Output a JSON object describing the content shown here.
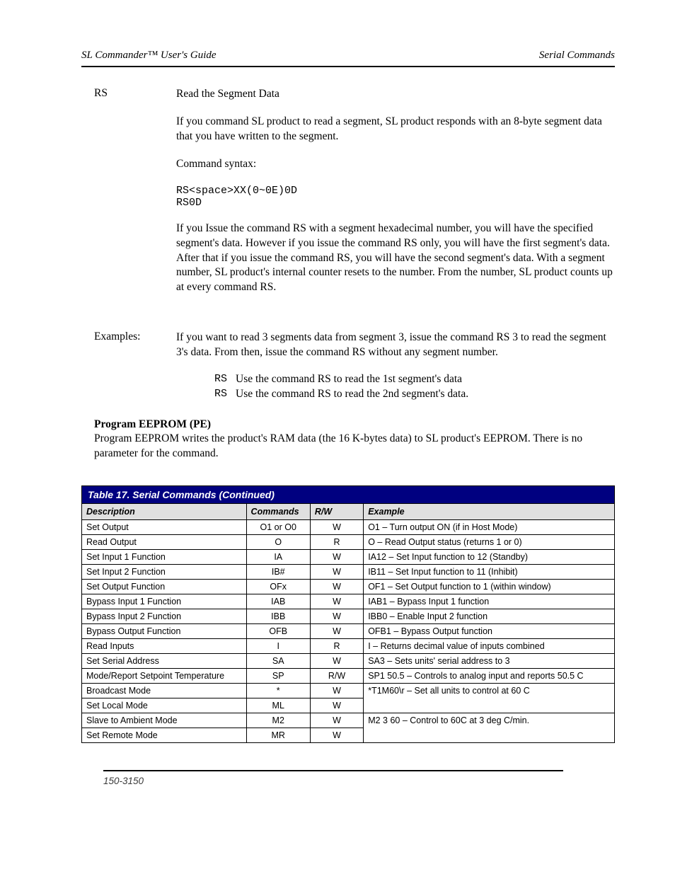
{
  "header": {
    "left": "SL Commander™ User's Guide",
    "right": "Serial Commands"
  },
  "rs": {
    "label": "RS",
    "p1": "Read the Segment Data",
    "p2": "If you command SL product to read a segment, SL product responds with an 8-byte segment data that you have written to the segment.",
    "syntax_label": "Command syntax:",
    "syntax_line1": "RS<space>XX(0~0E)0D",
    "syntax_line2": "RS0D",
    "p3": "If you Issue the command RS with a segment hexadecimal number, you will have the specified segment's data. However if you issue the command RS only, you will have the first segment's data. After that if you issue the command RS, you will have the second segment's data. With a segment number, SL product's internal counter resets to the number. From the number, SL product counts up at every command RS."
  },
  "ex": {
    "label": "Examples:",
    "p1": "If you want to read 3 segments data from segment 3, issue the command RS 3 to read the segment 3's data. From then, issue the command RS without any segment number.",
    "rows": [
      {
        "cmd": "RS",
        "desc": "Use the command RS to read the 1st segment's data"
      },
      {
        "cmd": "RS",
        "desc": "Use the command RS to read the 2nd segment's data."
      }
    ]
  },
  "pe": {
    "title": "Program EEPROM (PE)",
    "desc": "Program EEPROM writes the product's RAM data (the 16 K-bytes data) to SL product's EEPROM. There is no parameter for the command."
  },
  "table": {
    "title": "Table 17. Serial Commands (Continued)",
    "h_desc": "Description",
    "h_cmd": "Commands",
    "h_rw": "R/W",
    "h_ex": "Example",
    "rows": [
      {
        "d": "Set Output",
        "c": "O1 or O0",
        "rw": "W",
        "e": "O1 – Turn output ON (if in Host Mode)"
      },
      {
        "d": "Read Output",
        "c": "O",
        "rw": "R",
        "e": "O – Read Output status (returns 1 or 0)"
      },
      {
        "d": "Set Input 1 Function",
        "c": "IA",
        "rw": "W",
        "e": "IA12 – Set Input function to 12 (Standby)"
      },
      {
        "d": "Set Input 2 Function",
        "c": "IB#",
        "rw": "W",
        "e": "IB11 – Set Input function to 11 (Inhibit)"
      },
      {
        "d": "Set Output Function",
        "c": "OFx",
        "rw": "W",
        "e": "OF1 – Set Output function to 1 (within window)"
      },
      {
        "d": "Bypass Input 1 Function",
        "c": "IAB",
        "rw": "W",
        "e": "IAB1 – Bypass Input 1 function"
      },
      {
        "d": "Bypass Input 2 Function",
        "c": "IBB",
        "rw": "W",
        "e": "IBB0 – Enable Input 2 function"
      },
      {
        "d": "Bypass Output Function",
        "c": "OFB",
        "rw": "W",
        "e": "OFB1 – Bypass Output function"
      },
      {
        "d": "Read Inputs",
        "c": "I",
        "rw": "R",
        "e": "I – Returns decimal value of inputs combined"
      },
      {
        "d": "Set Serial Address",
        "c": "SA",
        "rw": "W",
        "e": "SA3 – Sets units' serial address to 3"
      },
      {
        "d": "Mode/Report Setpoint Temperature",
        "c": "SP",
        "rw": "R/W",
        "e": "SP1 50.5 – Controls to analog input and reports 50.5 C"
      },
      {
        "d": "Broadcast Mode",
        "c": "*",
        "rw": "W",
        "e": "*T1M60\\r – Set all units to control at 60 C",
        "rowspan": 2
      },
      {
        "d": "Set Local Mode",
        "c": "ML",
        "rw": "W"
      },
      {
        "d": "Slave to Ambient Mode",
        "c": "M2",
        "rw": "W",
        "e": "M2 3 60 – Control to 60C at 3 deg C/min.",
        "rowspan": 2
      },
      {
        "d": "Set Remote Mode",
        "c": "MR",
        "rw": "W"
      }
    ]
  },
  "footer": "150-3150"
}
